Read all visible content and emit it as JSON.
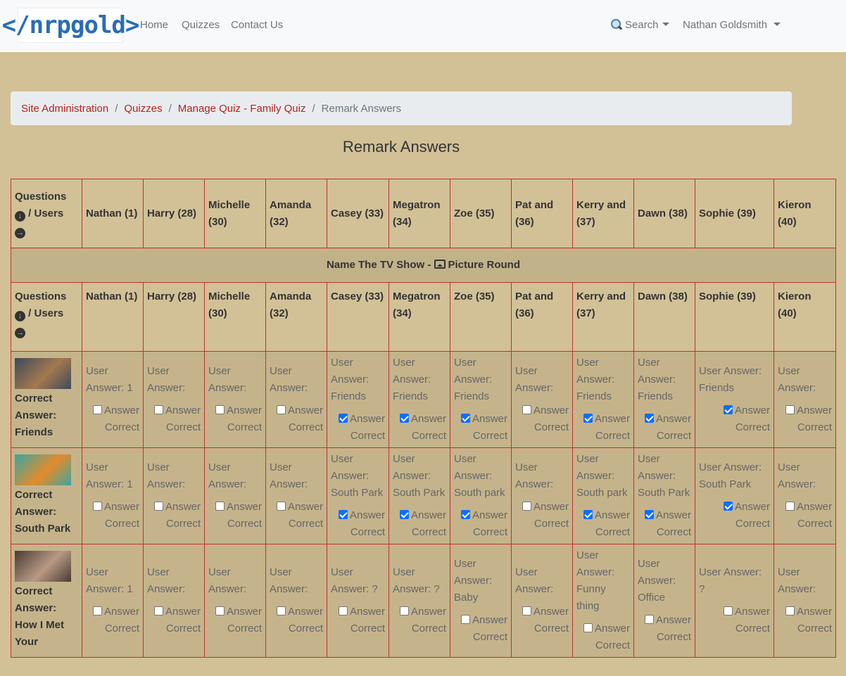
{
  "navbar": {
    "brand": "</nrpgold>",
    "links": [
      "Home",
      "Quizzes",
      "Contact Us"
    ],
    "search_label": "Search",
    "user_label": "Nathan Goldsmith"
  },
  "breadcrumb": {
    "items": [
      "Site Administration",
      "Quizzes",
      "Manage Quiz - Family Quiz"
    ],
    "active": "Remark Answers"
  },
  "page_title": "Remark Answers",
  "table": {
    "corner_header_lines": [
      "Questions",
      "/ Users"
    ],
    "users": [
      "Nathan (1)",
      "Harry (28)",
      "Michelle (30)",
      "Amanda (32)",
      "Casey (33)",
      "Megatron (34)",
      "Zoe (35)",
      "Pat and (36)",
      "Kerry and (37)",
      "Dawn (38)",
      "Sophie (39)",
      "Kieron (40)"
    ],
    "section_title": "Name The TV Show - ",
    "section_type": "Picture Round",
    "checkbox_label_1": "Answer",
    "checkbox_label_2": "Correct",
    "rows": [
      {
        "answer_label": "Correct Answer: Friends",
        "thumb_colors": [
          "#3d4a5a",
          "#a3794e"
        ],
        "cells": [
          {
            "answer": "User Answer: 1",
            "checked": false
          },
          {
            "answer": "User Answer:",
            "checked": false
          },
          {
            "answer": "User Answer:",
            "checked": false
          },
          {
            "answer": "User Answer:",
            "checked": false
          },
          {
            "answer": "User Answer: Friends",
            "checked": true
          },
          {
            "answer": "User Answer: Friends",
            "checked": true
          },
          {
            "answer": "User Answer: Friends",
            "checked": true
          },
          {
            "answer": "User Answer:",
            "checked": false
          },
          {
            "answer": "User Answer: Friends",
            "checked": true
          },
          {
            "answer": "User Answer: Friends",
            "checked": true
          },
          {
            "answer": "User Answer: Friends",
            "checked": true
          },
          {
            "answer": "User Answer:",
            "checked": false
          }
        ]
      },
      {
        "answer_label": "Correct Answer: South Park",
        "thumb_colors": [
          "#3aa6a1",
          "#e48b2c"
        ],
        "cells": [
          {
            "answer": "User Answer: 1",
            "checked": false
          },
          {
            "answer": "User Answer:",
            "checked": false
          },
          {
            "answer": "User Answer:",
            "checked": false
          },
          {
            "answer": "User Answer:",
            "checked": false
          },
          {
            "answer": "User Answer: South Park",
            "checked": true
          },
          {
            "answer": "User Answer: South Park",
            "checked": true
          },
          {
            "answer": "User Answer: South park",
            "checked": true
          },
          {
            "answer": "User Answer:",
            "checked": false
          },
          {
            "answer": "User Answer: South park",
            "checked": true
          },
          {
            "answer": "User Answer: South Park",
            "checked": true
          },
          {
            "answer": "User Answer: South Park",
            "checked": true
          },
          {
            "answer": "User Answer:",
            "checked": false
          }
        ]
      },
      {
        "answer_label": "Correct Answer: How I Met Your",
        "thumb_colors": [
          "#4a3a35",
          "#b89a84"
        ],
        "cells": [
          {
            "answer": "User Answer: 1",
            "checked": false
          },
          {
            "answer": "User Answer:",
            "checked": false
          },
          {
            "answer": "User Answer:",
            "checked": false
          },
          {
            "answer": "User Answer:",
            "checked": false
          },
          {
            "answer": "User Answer: ?",
            "checked": false
          },
          {
            "answer": "User Answer: ?",
            "checked": false
          },
          {
            "answer": "User Answer: Baby",
            "checked": false
          },
          {
            "answer": "User Answer:",
            "checked": false
          },
          {
            "answer": "User Answer: Funny thing",
            "checked": false
          },
          {
            "answer": "User Answer: Office",
            "checked": false
          },
          {
            "answer": "User Answer: ?",
            "checked": false
          },
          {
            "answer": "User Answer:",
            "checked": false
          }
        ]
      }
    ]
  },
  "colors": {
    "page_bg": "#d2c197",
    "table_border": "#c0312f",
    "breadcrumb_link": "#b22222",
    "row_bg": "#c5b48b"
  }
}
